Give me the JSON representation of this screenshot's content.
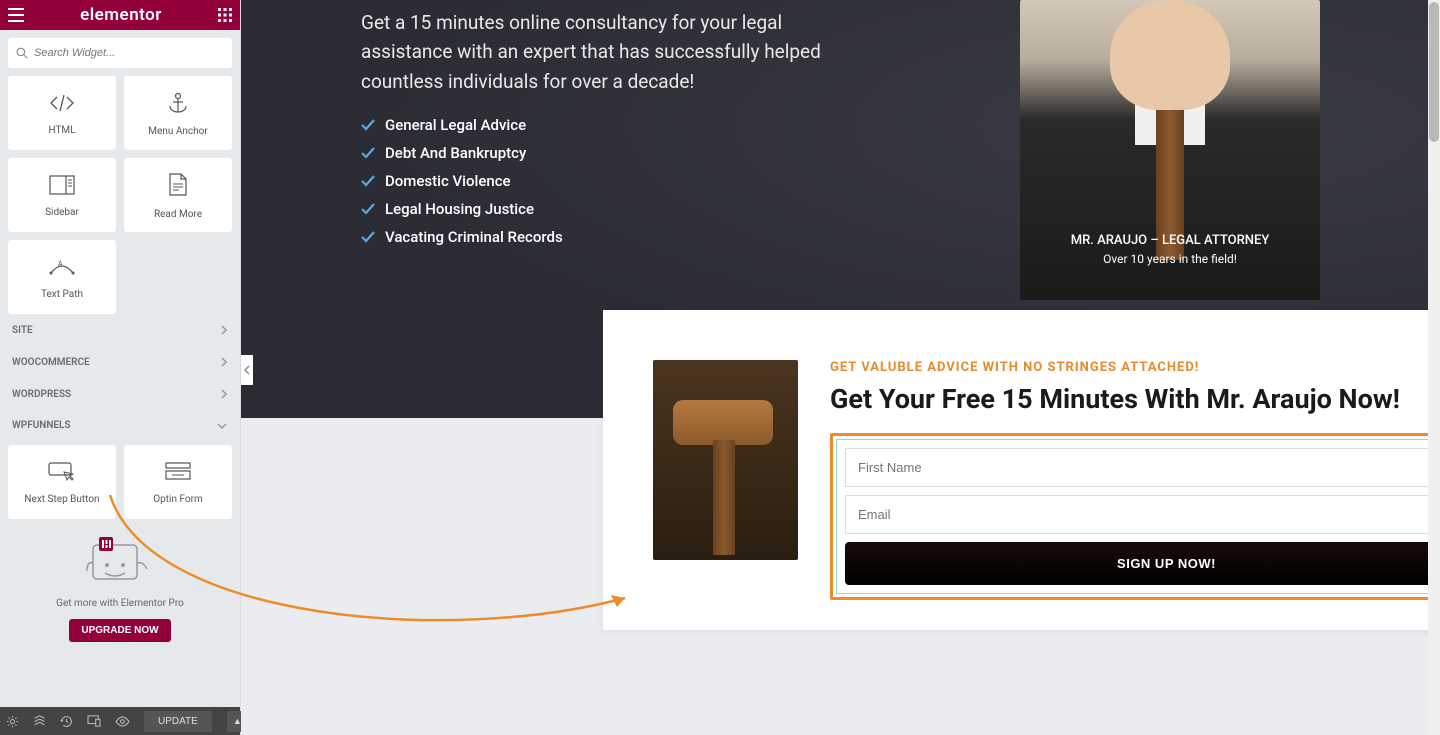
{
  "header": {
    "logo": "elementor"
  },
  "search": {
    "placeholder": "Search Widget..."
  },
  "widgets": {
    "html": "HTML",
    "menu_anchor": "Menu Anchor",
    "sidebar": "Sidebar",
    "read_more": "Read More",
    "text_path": "Text Path",
    "next_step": "Next Step Button",
    "optin_form": "Optin Form"
  },
  "categories": {
    "site": "SITE",
    "woo": "WOOCOMMERCE",
    "wp": "WORDPRESS",
    "wpfunnels": "WPFUNNELS"
  },
  "promo": {
    "text": "Get more with Elementor Pro",
    "button": "UPGRADE NOW"
  },
  "footer": {
    "update": "UPDATE"
  },
  "hero": {
    "desc": "Get a 15 minutes online consultancy for your legal assistance with an expert that has successfully helped countless individuals for over a decade!",
    "checks": [
      "General Legal Advice",
      "Debt And Bankruptcy",
      "Domestic Violence",
      "Legal Housing Justice",
      "Vacating Criminal Records"
    ],
    "lawyer_name": "MR. ARAUJO – LEGAL ATTORNEY",
    "lawyer_sub": "Over 10 years in the field!"
  },
  "form": {
    "eyebrow": "GET VALUBLE ADVICE WITH NO STRINGES ATTACHED!",
    "title": "Get Your Free 15 Minutes With Mr. Araujo Now!",
    "first_name_ph": "First Name",
    "email_ph": "Email",
    "button": "SIGN UP NOW!"
  }
}
